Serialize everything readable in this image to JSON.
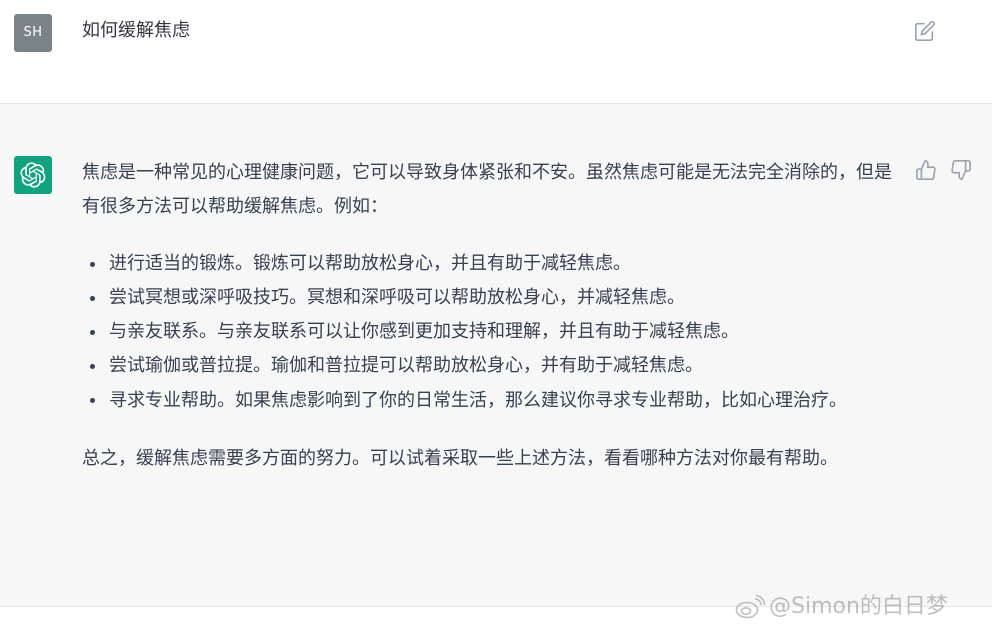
{
  "user_message": {
    "avatar_initials": "SH",
    "text": "如何缓解焦虑",
    "edit_icon": "edit-icon"
  },
  "assistant_message": {
    "intro": "焦虑是一种常见的心理健康问题，它可以导致身体紧张和不安。虽然焦虑可能是无法完全消除的，但是有很多方法可以帮助缓解焦虑。例如：",
    "bullets": [
      "进行适当的锻炼。锻炼可以帮助放松身心，并且有助于减轻焦虑。",
      "尝试冥想或深呼吸技巧。冥想和深呼吸可以帮助放松身心，并减轻焦虑。",
      "与亲友联系。与亲友联系可以让你感到更加支持和理解，并且有助于减轻焦虑。",
      "尝试瑜伽或普拉提。瑜伽和普拉提可以帮助放松身心，并有助于减轻焦虑。",
      "寻求专业帮助。如果焦虑影响到了你的日常生活，那么建议你寻求专业帮助，比如心理治疗。"
    ],
    "conclusion": "总之，缓解焦虑需要多方面的努力。可以试着采取一些上述方法，看看哪种方法对你最有帮助。",
    "feedback_icons": [
      "thumbs-up-icon",
      "thumbs-down-icon"
    ]
  },
  "watermark": {
    "text": "@Simon的白日梦"
  },
  "colors": {
    "avatar_bg": "#7a8387",
    "gpt_green": "#10a37f",
    "assistant_bg": "#f7f7f8",
    "text": "#374151"
  }
}
